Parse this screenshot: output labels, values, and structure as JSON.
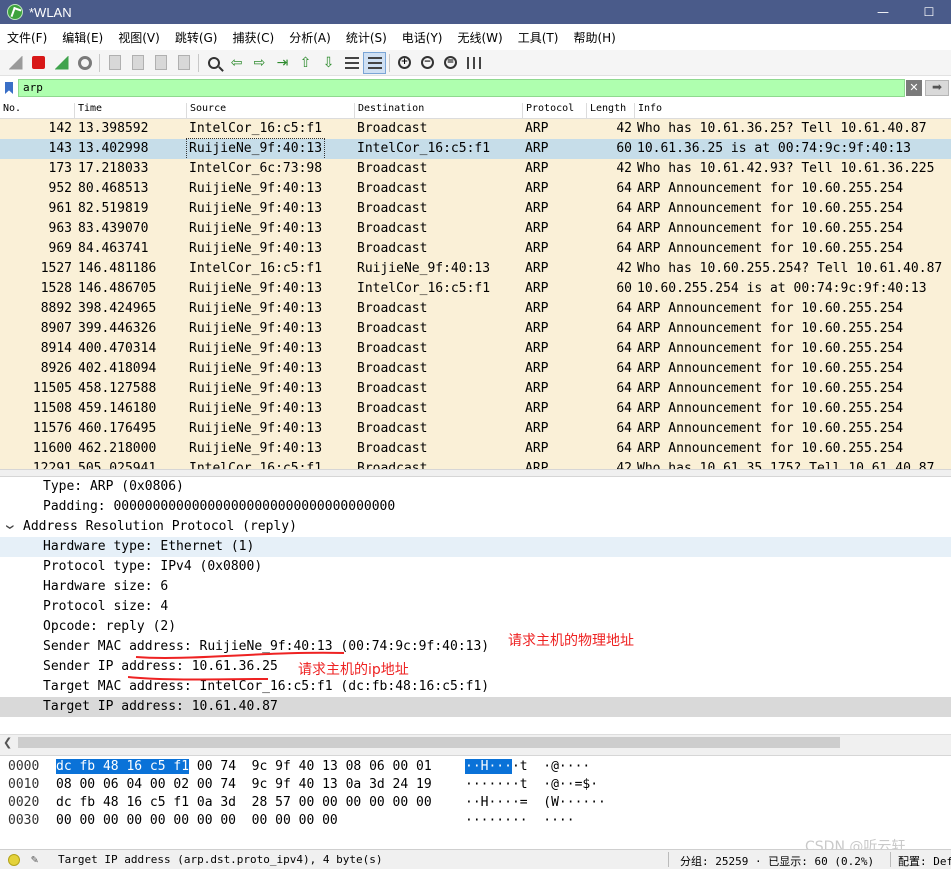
{
  "window": {
    "title": "*WLAN",
    "minimize": "—",
    "maximize": "☐"
  },
  "menu": [
    "文件(F)",
    "编辑(E)",
    "视图(V)",
    "跳转(G)",
    "捕获(C)",
    "分析(A)",
    "统计(S)",
    "电话(Y)",
    "无线(W)",
    "工具(T)",
    "帮助(H)"
  ],
  "filter": {
    "value": "arp",
    "clear": "✕",
    "apply": "➡"
  },
  "columns": {
    "no": "No.",
    "time": "Time",
    "source": "Source",
    "destination": "Destination",
    "protocol": "Protocol",
    "length": "Length",
    "info": "Info"
  },
  "packets": [
    {
      "no": "142",
      "time": "13.398592",
      "src": "IntelCor_16:c5:f1",
      "dst": "Broadcast",
      "proto": "ARP",
      "len": "42",
      "info": "Who has 10.61.36.25? Tell 10.61.40.87"
    },
    {
      "no": "143",
      "time": "13.402998",
      "src": "RuijieNe_9f:40:13",
      "dst": "IntelCor_16:c5:f1",
      "proto": "ARP",
      "len": "60",
      "info": "10.61.36.25 is at 00:74:9c:9f:40:13"
    },
    {
      "no": "173",
      "time": "17.218033",
      "src": "IntelCor_6c:73:98",
      "dst": "Broadcast",
      "proto": "ARP",
      "len": "42",
      "info": "Who has 10.61.42.93? Tell 10.61.36.225"
    },
    {
      "no": "952",
      "time": "80.468513",
      "src": "RuijieNe_9f:40:13",
      "dst": "Broadcast",
      "proto": "ARP",
      "len": "64",
      "info": "ARP Announcement for 10.60.255.254"
    },
    {
      "no": "961",
      "time": "82.519819",
      "src": "RuijieNe_9f:40:13",
      "dst": "Broadcast",
      "proto": "ARP",
      "len": "64",
      "info": "ARP Announcement for 10.60.255.254"
    },
    {
      "no": "963",
      "time": "83.439070",
      "src": "RuijieNe_9f:40:13",
      "dst": "Broadcast",
      "proto": "ARP",
      "len": "64",
      "info": "ARP Announcement for 10.60.255.254"
    },
    {
      "no": "969",
      "time": "84.463741",
      "src": "RuijieNe_9f:40:13",
      "dst": "Broadcast",
      "proto": "ARP",
      "len": "64",
      "info": "ARP Announcement for 10.60.255.254"
    },
    {
      "no": "1527",
      "time": "146.481186",
      "src": "IntelCor_16:c5:f1",
      "dst": "RuijieNe_9f:40:13",
      "proto": "ARP",
      "len": "42",
      "info": "Who has 10.60.255.254? Tell 10.61.40.87"
    },
    {
      "no": "1528",
      "time": "146.486705",
      "src": "RuijieNe_9f:40:13",
      "dst": "IntelCor_16:c5:f1",
      "proto": "ARP",
      "len": "60",
      "info": "10.60.255.254 is at 00:74:9c:9f:40:13"
    },
    {
      "no": "8892",
      "time": "398.424965",
      "src": "RuijieNe_9f:40:13",
      "dst": "Broadcast",
      "proto": "ARP",
      "len": "64",
      "info": "ARP Announcement for 10.60.255.254"
    },
    {
      "no": "8907",
      "time": "399.446326",
      "src": "RuijieNe_9f:40:13",
      "dst": "Broadcast",
      "proto": "ARP",
      "len": "64",
      "info": "ARP Announcement for 10.60.255.254"
    },
    {
      "no": "8914",
      "time": "400.470314",
      "src": "RuijieNe_9f:40:13",
      "dst": "Broadcast",
      "proto": "ARP",
      "len": "64",
      "info": "ARP Announcement for 10.60.255.254"
    },
    {
      "no": "8926",
      "time": "402.418094",
      "src": "RuijieNe_9f:40:13",
      "dst": "Broadcast",
      "proto": "ARP",
      "len": "64",
      "info": "ARP Announcement for 10.60.255.254"
    },
    {
      "no": "11505",
      "time": "458.127588",
      "src": "RuijieNe_9f:40:13",
      "dst": "Broadcast",
      "proto": "ARP",
      "len": "64",
      "info": "ARP Announcement for 10.60.255.254"
    },
    {
      "no": "11508",
      "time": "459.146180",
      "src": "RuijieNe_9f:40:13",
      "dst": "Broadcast",
      "proto": "ARP",
      "len": "64",
      "info": "ARP Announcement for 10.60.255.254"
    },
    {
      "no": "11576",
      "time": "460.176495",
      "src": "RuijieNe_9f:40:13",
      "dst": "Broadcast",
      "proto": "ARP",
      "len": "64",
      "info": "ARP Announcement for 10.60.255.254"
    },
    {
      "no": "11600",
      "time": "462.218000",
      "src": "RuijieNe_9f:40:13",
      "dst": "Broadcast",
      "proto": "ARP",
      "len": "64",
      "info": "ARP Announcement for 10.60.255.254"
    },
    {
      "no": "12291",
      "time": "505.025941",
      "src": "IntelCor_16:c5:f1",
      "dst": "Broadcast",
      "proto": "ARP",
      "len": "42",
      "info": "Who has 10.61.35.175? Tell 10.61.40.87"
    }
  ],
  "selected_packet_index": 1,
  "details": [
    {
      "text": "Type: ARP (0x0806)",
      "level": 1
    },
    {
      "text": "Padding: 000000000000000000000000000000000000",
      "level": 1
    },
    {
      "text": "Address Resolution Protocol (reply)",
      "level": 0,
      "expanded": true
    },
    {
      "text": "Hardware type: Ethernet (1)",
      "level": 1,
      "highlight": true
    },
    {
      "text": "Protocol type: IPv4 (0x0800)",
      "level": 1
    },
    {
      "text": "Hardware size: 6",
      "level": 1
    },
    {
      "text": "Protocol size: 4",
      "level": 1
    },
    {
      "text": "Opcode: reply (2)",
      "level": 1
    },
    {
      "text": "Sender MAC address: RuijieNe_9f:40:13 (00:74:9c:9f:40:13)",
      "level": 1
    },
    {
      "text": "Sender IP address: 10.61.36.25",
      "level": 1
    },
    {
      "text": "Target MAC address: IntelCor_16:c5:f1 (dc:fb:48:16:c5:f1)",
      "level": 1
    },
    {
      "text": "Target IP address: 10.61.40.87",
      "level": 1,
      "selected": true
    }
  ],
  "annotations": {
    "mac_note": "请求主机的物理地址",
    "ip_note": "请求主机的ip地址",
    "color": "#ee2222"
  },
  "bytes": [
    {
      "offset": "0000",
      "hex_hl": "dc fb 48 16 c5 f1",
      "hex_rest": " 00 74  9c 9f 40 13 08 06 00 01",
      "ascii_hl": "··H···",
      "ascii_rest": "·t  ·@····"
    },
    {
      "offset": "0010",
      "hex_hl": "",
      "hex_rest": "08 00 06 04 00 02 00 74  9c 9f 40 13 0a 3d 24 19",
      "ascii_hl": "",
      "ascii_rest": "·······t  ·@··=$·"
    },
    {
      "offset": "0020",
      "hex_hl": "",
      "hex_rest": "dc fb 48 16 c5 f1 0a 3d  28 57 00 00 00 00 00 00",
      "ascii_hl": "",
      "ascii_rest": "··H····=  (W······"
    },
    {
      "offset": "0030",
      "hex_hl": "",
      "hex_rest": "00 00 00 00 00 00 00 00  00 00 00 00",
      "ascii_hl": "",
      "ascii_rest": "········  ····"
    }
  ],
  "status": {
    "field": "Target IP address (arp.dst.proto_ipv4), 4 byte(s)",
    "packets": "分组: 25259 · 已显示: 60 (0.2%)",
    "profile": "配置: Def"
  },
  "watermark": "CSDN @听云轩",
  "colors": {
    "title_bar": "#4a5b8a",
    "filter_ok": "#afffaf",
    "arp_row": "#faf0d7",
    "selected_row": "#c6dde9",
    "hex_highlight": "#0a72d8"
  }
}
